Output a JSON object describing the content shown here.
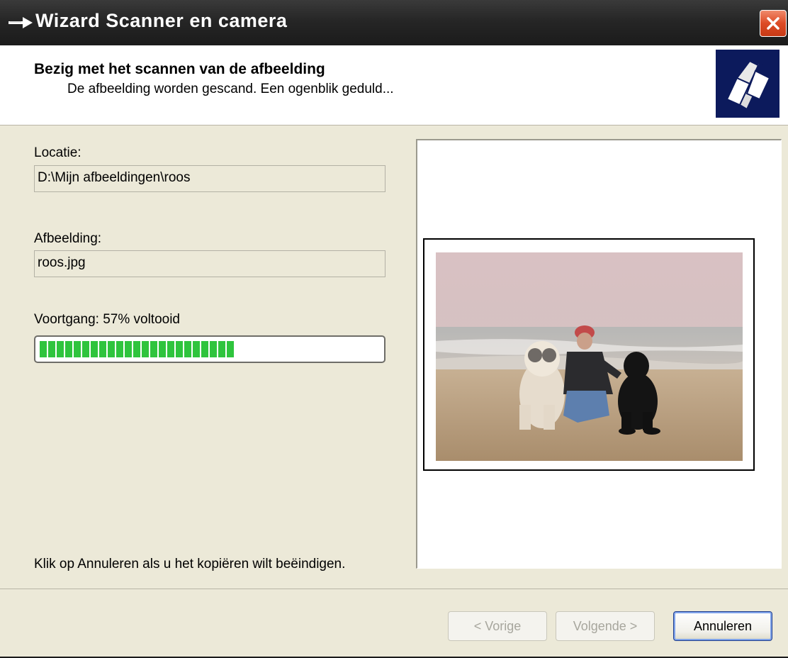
{
  "window": {
    "title": "Wizard Scanner en camera"
  },
  "header": {
    "title": "Bezig met het scannen van de afbeelding",
    "subtitle": "De afbeelding worden gescand. Een ogenblik geduld..."
  },
  "location": {
    "label": "Locatie:",
    "value": "D:\\Mijn afbeeldingen\\roos"
  },
  "image": {
    "label": "Afbeelding:",
    "value": "roos.jpg"
  },
  "progress": {
    "label": "Voortgang: 57% voltooid",
    "percent": 57
  },
  "hint": "Klik op Annuleren als u het kopiëren wilt beëindigen.",
  "buttons": {
    "back": "< Vorige",
    "next": "Volgende >",
    "cancel": "Annuleren"
  },
  "icons": {
    "title": "scanner-arrow-icon",
    "close": "close-icon",
    "logo": "wizard-logo-icon"
  },
  "colors": {
    "progress": "#2fc43d",
    "close": "#dd4b25",
    "titlebar": "#262626"
  }
}
